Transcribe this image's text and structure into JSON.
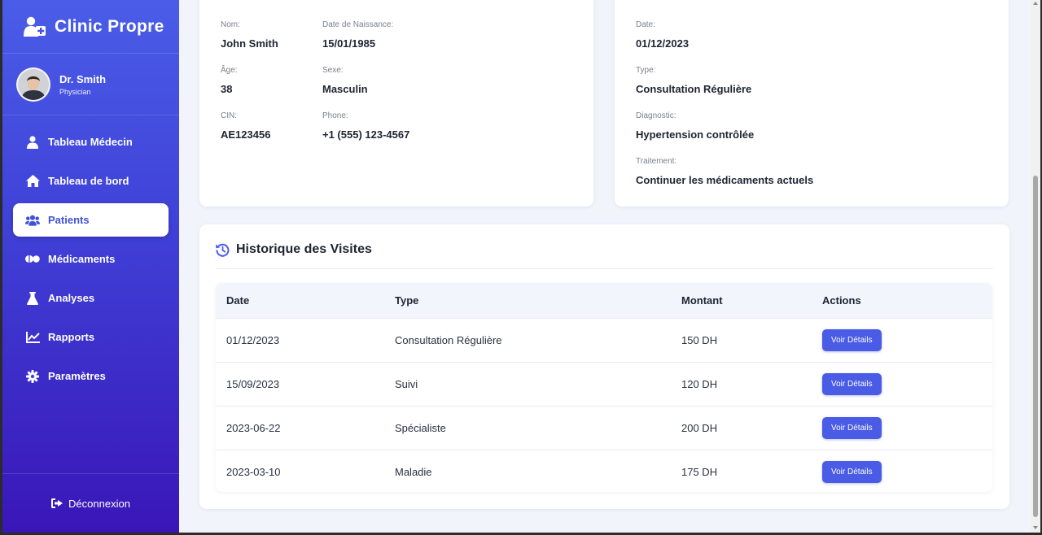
{
  "brand": {
    "title": "Clinic Propre",
    "icon": "clinic-user-icon"
  },
  "user": {
    "name": "Dr. Smith",
    "role": "Physician"
  },
  "nav": [
    {
      "label": "Tableau Médecin",
      "icon": "user-icon",
      "active": false
    },
    {
      "label": "Tableau de bord",
      "icon": "home-icon",
      "active": false
    },
    {
      "label": "Patients",
      "icon": "users-icon",
      "active": true
    },
    {
      "label": "Médicaments",
      "icon": "pills-icon",
      "active": false
    },
    {
      "label": "Analyses",
      "icon": "flask-icon",
      "active": false
    },
    {
      "label": "Rapports",
      "icon": "chart-line-icon",
      "active": false
    },
    {
      "label": "Paramètres",
      "icon": "gear-icon",
      "active": false
    }
  ],
  "logout": {
    "label": "Déconnexion",
    "icon": "sign-out-icon"
  },
  "patient": {
    "nom_label": "Nom:",
    "nom": "John Smith",
    "dob_label": "Date de Naissance:",
    "dob": "15/01/1985",
    "age_label": "Âge:",
    "age": "38",
    "sexe_label": "Sexe:",
    "sexe": "Masculin",
    "cin_label": "CIN:",
    "cin": "AE123456",
    "phone_label": "Phone:",
    "phone": "+1 (555) 123-4567"
  },
  "last_visit": {
    "date_label": "Date:",
    "date": "01/12/2023",
    "type_label": "Type:",
    "type": "Consultation Régulière",
    "diagnostic_label": "Diagnostic:",
    "diagnostic": "Hypertension contrôlée",
    "traitement_label": "Traitement:",
    "traitement": "Continuer les médicaments actuels"
  },
  "history": {
    "title": "Historique des Visites",
    "icon": "history-icon",
    "columns": [
      "Date",
      "Type",
      "Montant",
      "Actions"
    ],
    "button_label": "Voir Détails",
    "rows": [
      {
        "date": "01/12/2023",
        "type": "Consultation Régulière",
        "amount": "150 DH"
      },
      {
        "date": "15/09/2023",
        "type": "Suivi",
        "amount": "120 DH"
      },
      {
        "date": "2023-06-22",
        "type": "Spécialiste",
        "amount": "200 DH"
      },
      {
        "date": "2023-03-10",
        "type": "Maladie",
        "amount": "175 DH"
      }
    ]
  },
  "colors": {
    "accent": "#4a5be6",
    "sidebar_top": "#4a5de8",
    "sidebar_bottom": "#3a16b8"
  }
}
